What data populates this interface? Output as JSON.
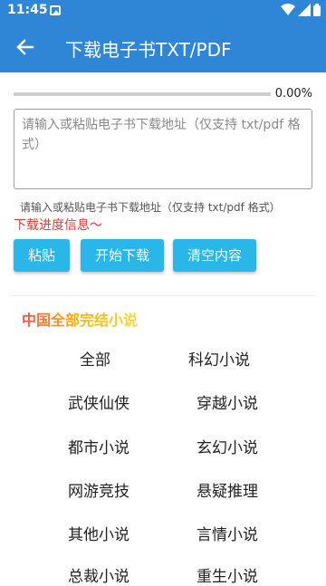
{
  "status": {
    "time": "11:45"
  },
  "appbar": {
    "title": "下载电子书TXT/PDF"
  },
  "progress": {
    "value": 0.0,
    "label": "0.00%"
  },
  "url_input": {
    "placeholder": "请输入或粘贴电子书下载地址（仅支持 txt/pdf 格式）",
    "value": ""
  },
  "hint": "请输入或粘贴电子书下载地址（仅支持 txt/pdf 格式）",
  "progress_info": "下载进度信息～",
  "buttons": {
    "paste": "粘贴",
    "start": "开始下载",
    "clear": "清空内容"
  },
  "category_title": "中国全部完结小说",
  "categories": [
    "全部",
    "科幻小说",
    "武侠仙侠",
    "穿越小说",
    "都市小说",
    "玄幻小说",
    "网游竞技",
    "悬疑推理",
    "其他小说",
    "言情小说",
    "总裁小说",
    "重生小说"
  ],
  "colors": {
    "appbar": "#2f86d6",
    "button": "#29b6e8",
    "info_text": "#e53935"
  }
}
